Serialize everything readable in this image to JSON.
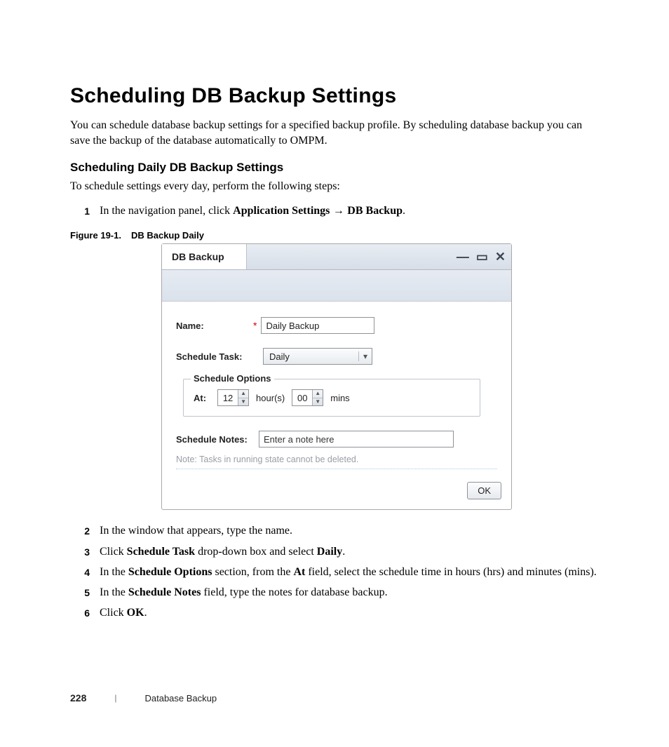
{
  "title": "Scheduling DB Backup Settings",
  "intro": "You can schedule database backup settings for a specified backup profile. By scheduling database backup you can save the backup of the database automatically to OMPM.",
  "subheading": "Scheduling Daily DB Backup Settings",
  "lead": "To schedule settings every day, perform the following steps:",
  "step1": {
    "num": "1",
    "pre": "In the navigation panel, click ",
    "b1": "Application Settings",
    "arrow": " → ",
    "b2": "DB Backup",
    "post": "."
  },
  "figure": {
    "id": "Figure 19-1.",
    "caption": "DB Backup Daily"
  },
  "dialog": {
    "title": "DB Backup",
    "window_controls": {
      "min": "—",
      "max": "▭",
      "close": "✕"
    },
    "name_label": "Name:",
    "name_value": "Daily Backup",
    "task_label": "Schedule Task:",
    "task_value": "Daily",
    "options_legend": "Schedule Options",
    "at_label": "At:",
    "hours_value": "12",
    "hours_unit": "hour(s)",
    "mins_value": "00",
    "mins_unit": "mins",
    "notes_label": "Schedule Notes:",
    "notes_placeholder": "Enter a note here",
    "footnote": "Note: Tasks in running state cannot be deleted.",
    "ok": "OK"
  },
  "step2": {
    "num": "2",
    "text": "In the window that appears, type the name."
  },
  "step3": {
    "num": "3",
    "pre": "Click ",
    "b1": "Schedule Task",
    "mid": " drop-down box and select ",
    "b2": "Daily",
    "post": "."
  },
  "step4": {
    "num": "4",
    "pre": "In the ",
    "b1": "Schedule Options",
    "mid1": " section, from the ",
    "b2": "At",
    "mid2": " field, select the schedule time in hours (hrs) and minutes (mins)."
  },
  "step5": {
    "num": "5",
    "pre": "In the ",
    "b1": "Schedule Notes",
    "post": " field, type the notes for database backup."
  },
  "step6": {
    "num": "6",
    "pre": "Click ",
    "b1": "OK",
    "post": "."
  },
  "footer": {
    "page": "228",
    "section": "Database Backup",
    "sep": "|"
  }
}
